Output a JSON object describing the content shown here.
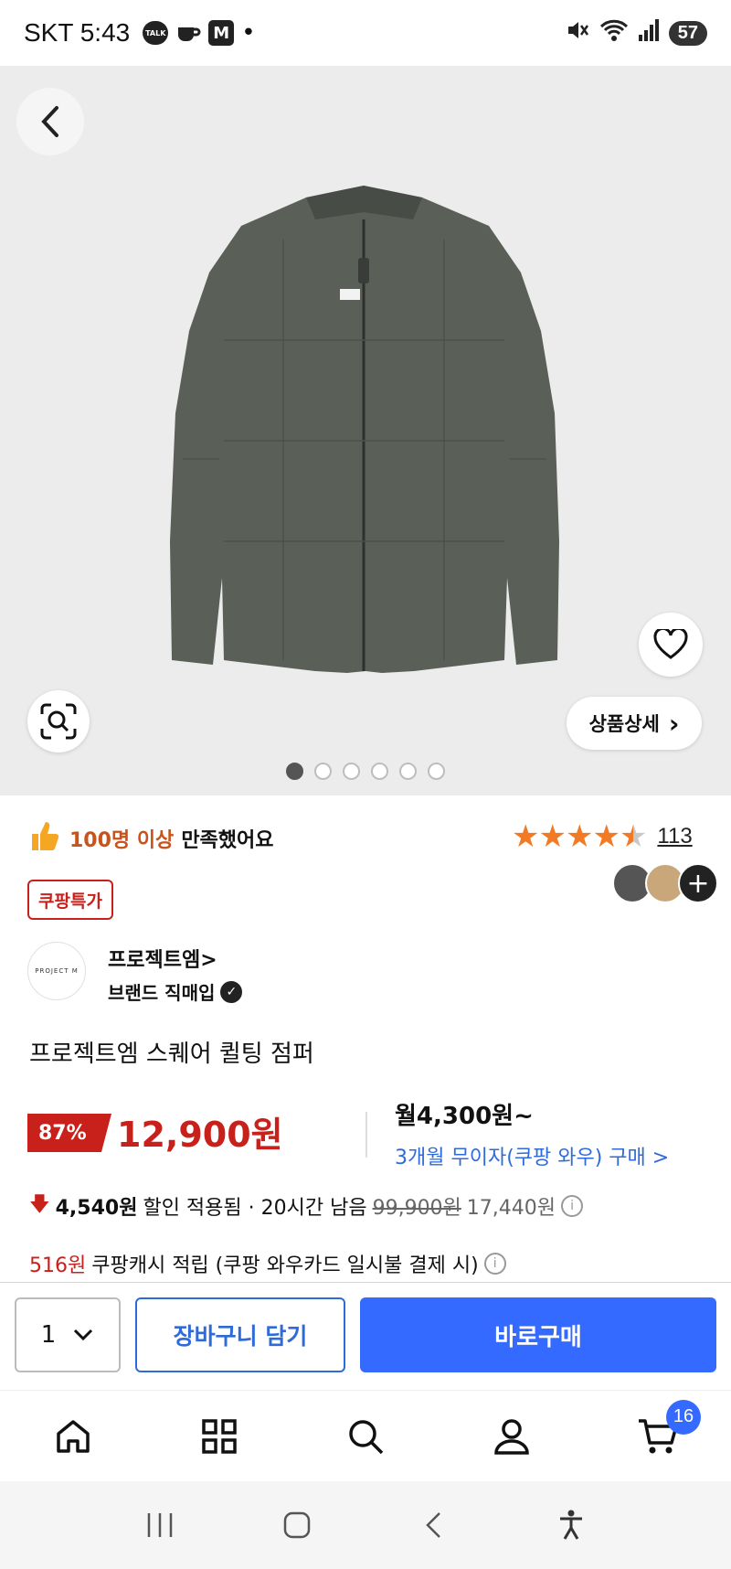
{
  "status_bar": {
    "time": "SKT 5:43",
    "talk_label": "TALK",
    "m_label": "M",
    "dot": "•",
    "battery": "57"
  },
  "hero": {
    "detail_button_label": "상품상세",
    "detail_chevron": "›",
    "image_dot_count": 6,
    "active_dot": 0
  },
  "rating": {
    "satisfaction_highlight": "100명 이상",
    "satisfaction_suffix": "만족했어요",
    "stars": 4.5,
    "review_count": "113"
  },
  "badge": "쿠팡특가",
  "brand": {
    "logo_text": "PROJECT M",
    "name": "프로젝트엠>",
    "subtitle": "브랜드 직매입"
  },
  "product": {
    "title": "프로젝트엠 스퀘어 퀼팅 점퍼",
    "discount_rate": "87%",
    "price": "12,900원",
    "monthly": "월4,300원~",
    "installment": "3개월 무이자(쿠팡 와우) 구매 >"
  },
  "discount_info": {
    "amount": "4,540원",
    "applied": "할인 적용됨 · 20시간 남음",
    "original": "99,900원",
    "before_coupon": "17,440원"
  },
  "cash": {
    "amount": "516원",
    "text": "쿠팡캐시 적립 (쿠팡 와우카드 일시불 결제 시)"
  },
  "action_bar": {
    "quantity": "1",
    "cart_label": "장바구니 담기",
    "buy_label": "바로구매"
  },
  "bottom_nav": {
    "cart_count": "16"
  },
  "colors": {
    "accent_red": "#c8211b",
    "brand_blue": "#346aff",
    "rating_orange": "#f37a24"
  }
}
